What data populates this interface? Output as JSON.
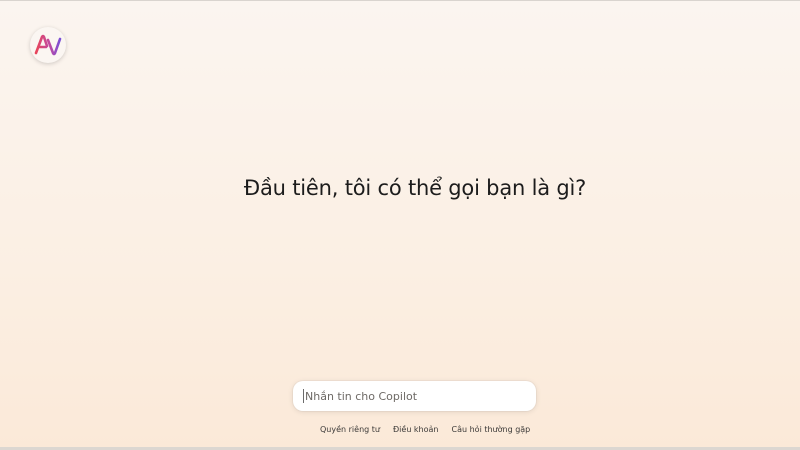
{
  "logo": {
    "name": "copilot-logo-icon",
    "colors": {
      "left": "#e24b5b",
      "right": "#7a4fd6"
    }
  },
  "main": {
    "question": "Đầu tiên, tôi có thể gọi bạn là gì?"
  },
  "composer": {
    "placeholder": "Nhắn tin cho Copilot"
  },
  "footer": {
    "links": [
      {
        "label": "Quyền riêng tư"
      },
      {
        "label": "Điều khoản"
      },
      {
        "label": "Câu hỏi thường gặp"
      }
    ]
  }
}
